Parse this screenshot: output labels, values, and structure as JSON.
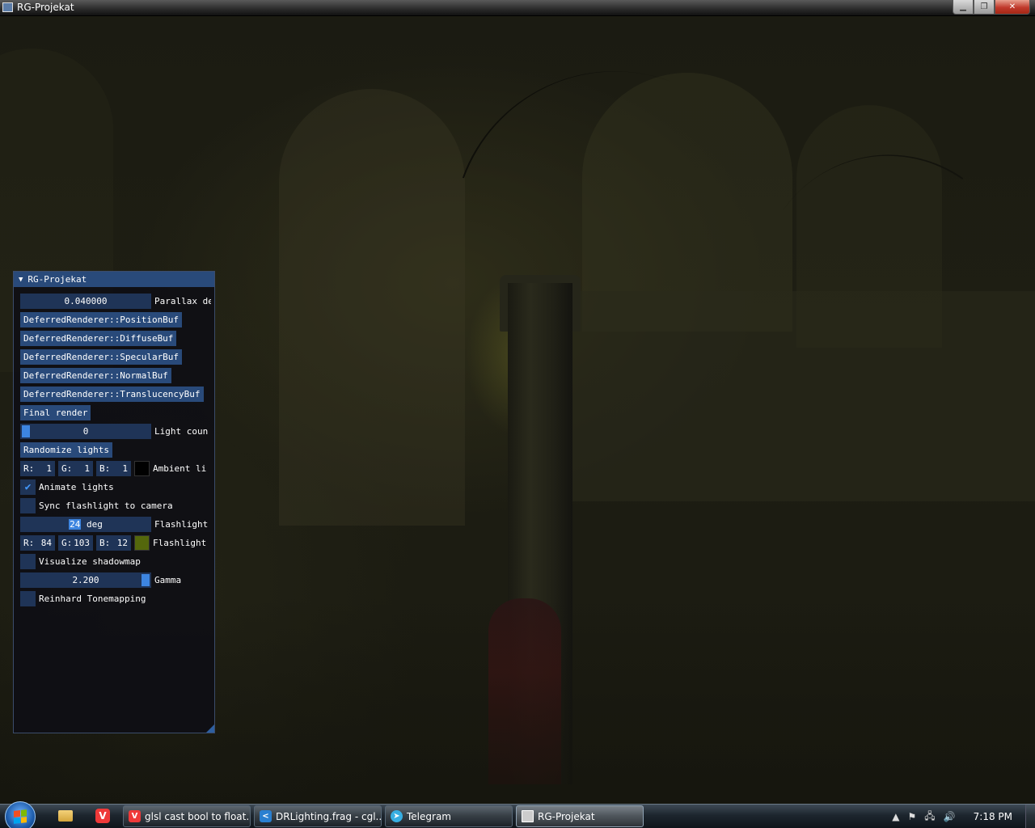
{
  "window": {
    "title": "RG-Projekat",
    "buttons": {
      "minimize": "▁",
      "maximize": "❐",
      "close": "✕"
    }
  },
  "imgui": {
    "title": "RG-Projekat",
    "parallax": {
      "value": "0.040000",
      "label": "Parallax de"
    },
    "buffers": [
      "DeferredRenderer::PositionBuf",
      "DeferredRenderer::DiffuseBuf",
      "DeferredRenderer::SpecularBuf",
      "DeferredRenderer::NormalBuf",
      "DeferredRenderer::TranslucencyBuf"
    ],
    "final_render": "Final render",
    "light_count": {
      "value": "0",
      "label": "Light coun"
    },
    "randomize": "Randomize lights",
    "ambient": {
      "r": "1",
      "g": "1",
      "b": "1",
      "label": "Ambient li",
      "color": "#010101"
    },
    "animate_lights": {
      "label": "Animate lights",
      "checked": true,
      "check": "✔"
    },
    "sync_flashlight": {
      "label": "Sync flashlight to camera",
      "checked": false
    },
    "flashlight_angle": {
      "value_sel": "24",
      "value_rest": " deg",
      "label": "Flashlight"
    },
    "flashlight_color": {
      "r": "84",
      "g": "103",
      "b": "12",
      "label": "Flashlight",
      "color": "#54670c"
    },
    "visualize_shadowmap": {
      "label": "Visualize shadowmap",
      "checked": false
    },
    "gamma": {
      "value": "2.200",
      "label": "Gamma"
    },
    "reinhard": {
      "label": "Reinhard Tonemapping",
      "checked": false
    },
    "channel_labels": {
      "r": "R:",
      "g": "G:",
      "b": "B:"
    }
  },
  "taskbar": {
    "tasks": [
      {
        "label": "glsl cast bool to float...",
        "icon": "vivaldi-icon"
      },
      {
        "label": "DRLighting.frag - cgl...",
        "icon": "vscode-icon"
      },
      {
        "label": "Telegram",
        "icon": "telegram-icon"
      },
      {
        "label": "RG-Projekat",
        "icon": "window-icon"
      }
    ],
    "clock": "7:18 PM"
  }
}
